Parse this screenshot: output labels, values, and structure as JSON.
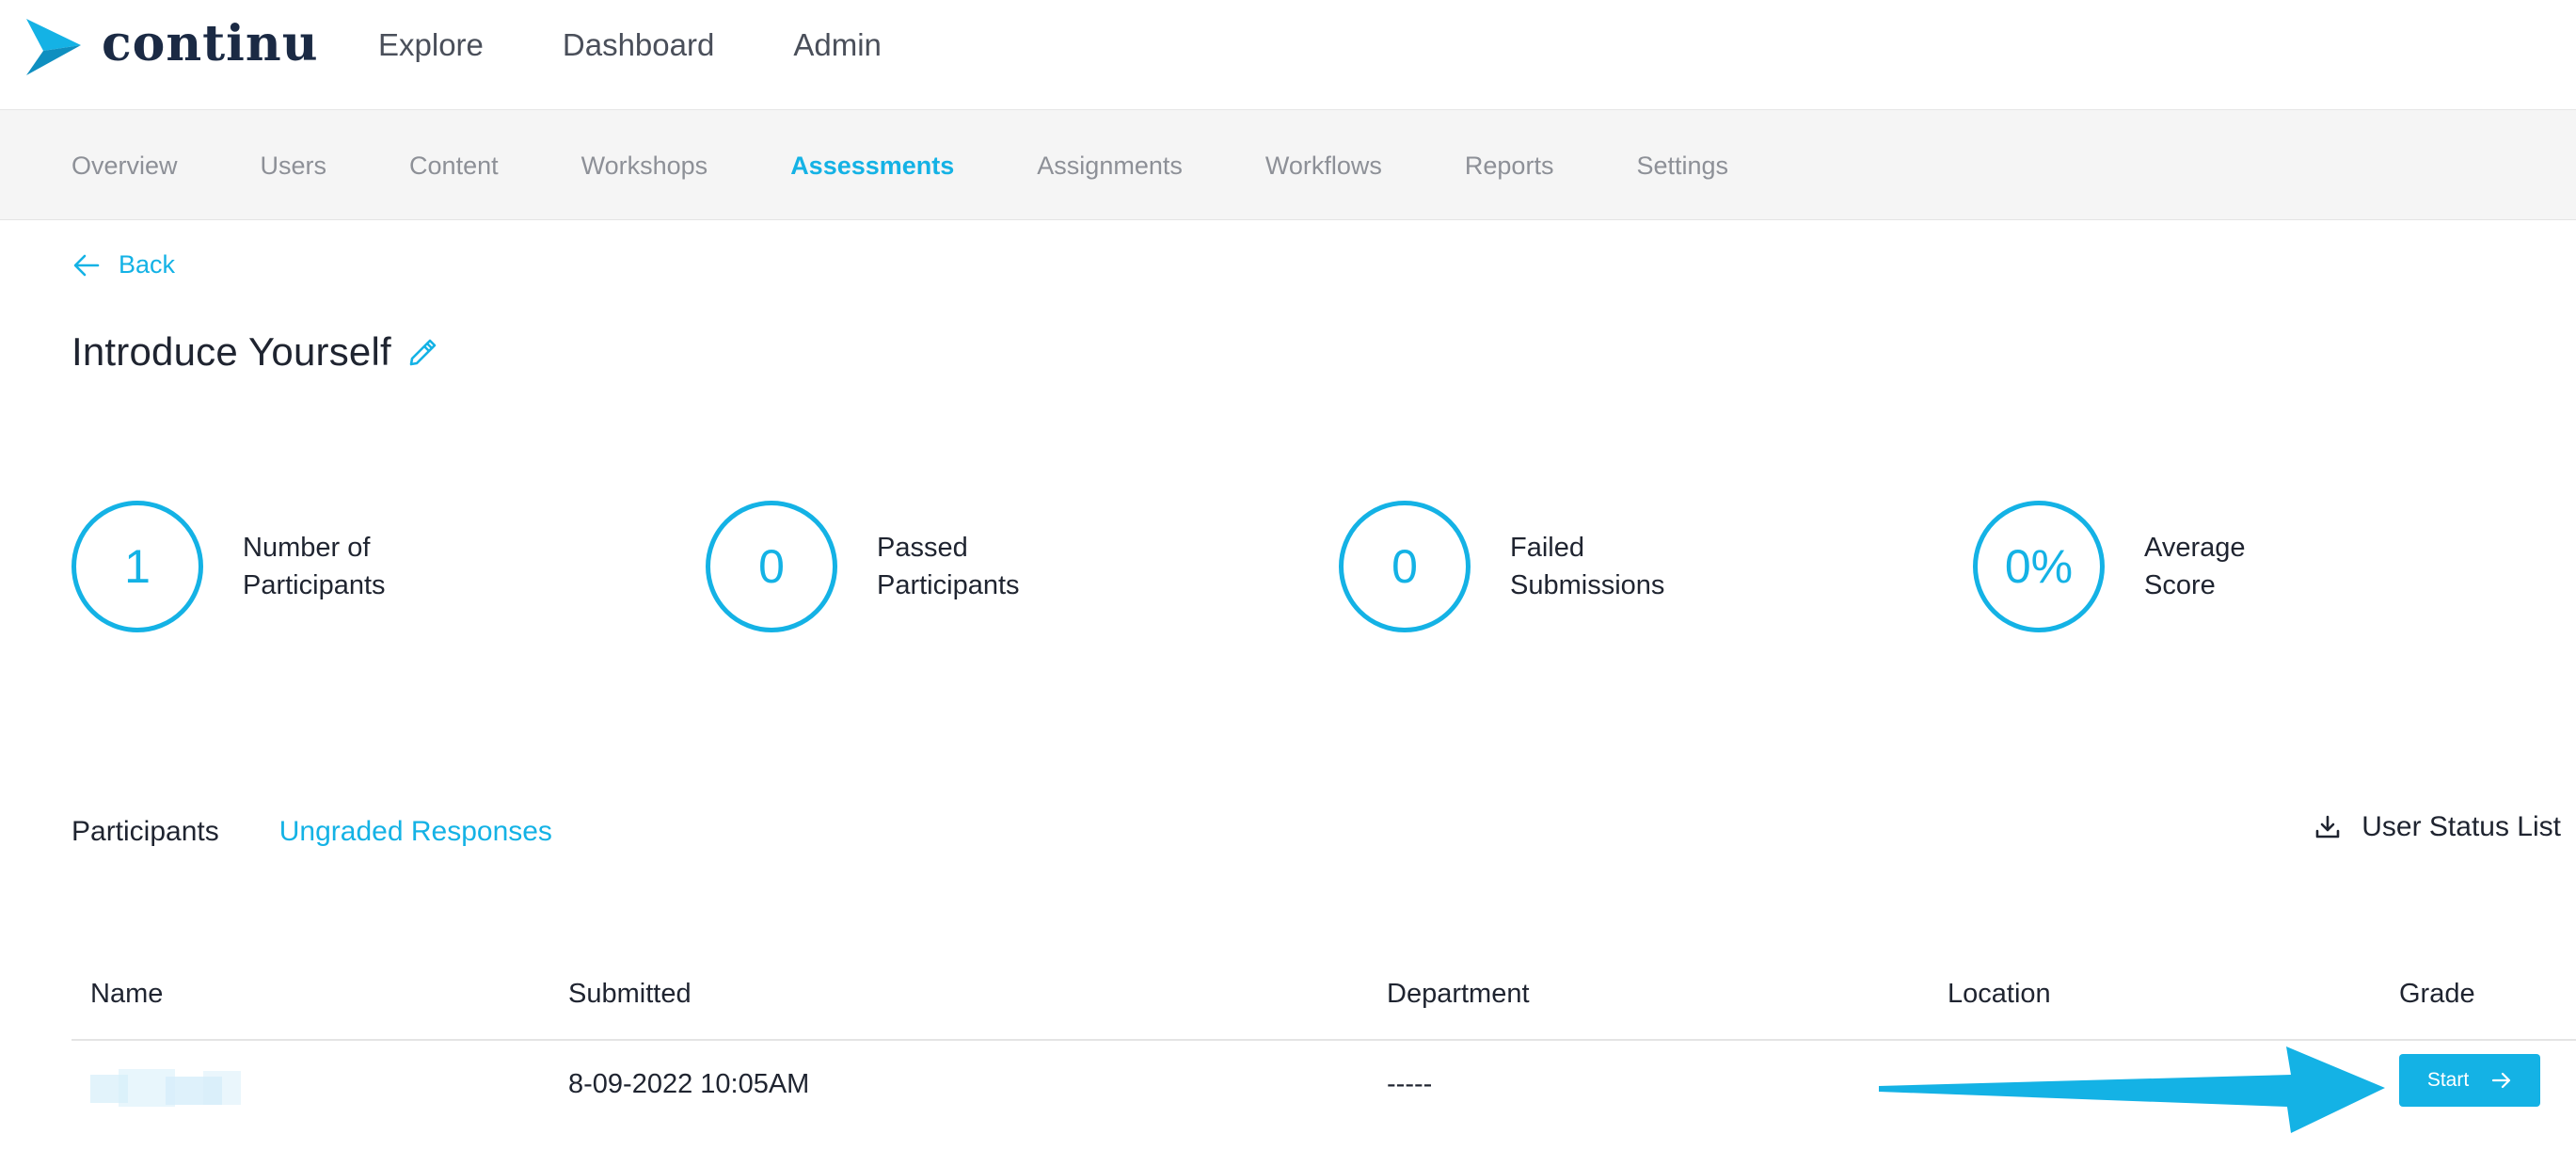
{
  "brand": {
    "name": "continu",
    "accent": "#14b2e5",
    "dark": "#1b2a44"
  },
  "top_nav": {
    "items": [
      "Explore",
      "Dashboard",
      "Admin"
    ]
  },
  "sub_nav": {
    "items": [
      "Overview",
      "Users",
      "Content",
      "Workshops",
      "Assessments",
      "Assignments",
      "Workflows",
      "Reports",
      "Settings"
    ],
    "active": "Assessments"
  },
  "back_label": "Back",
  "page_title": "Introduce Yourself",
  "stats": [
    {
      "value": "1",
      "label_line1": "Number of",
      "label_line2": "Participants"
    },
    {
      "value": "0",
      "label_line1": "Passed",
      "label_line2": "Participants"
    },
    {
      "value": "0",
      "label_line1": "Failed",
      "label_line2": "Submissions"
    },
    {
      "value": "0%",
      "label_line1": "Average",
      "label_line2": "Score"
    }
  ],
  "tabs": {
    "participants": "Participants",
    "ungraded": "Ungraded Responses",
    "active": "Ungraded Responses"
  },
  "user_status_list": "User Status List",
  "table": {
    "headers": {
      "name": "Name",
      "submitted": "Submitted",
      "department": "Department",
      "location": "Location",
      "grade": "Grade"
    },
    "rows": [
      {
        "name": "",
        "submitted": "8-09-2022 10:05AM",
        "department": "-----",
        "location": "",
        "grade_button": "Start"
      }
    ]
  },
  "icons": {
    "back": "arrow-left-icon",
    "edit": "pencil-icon",
    "download": "download-icon",
    "start": "arrow-right-icon"
  }
}
